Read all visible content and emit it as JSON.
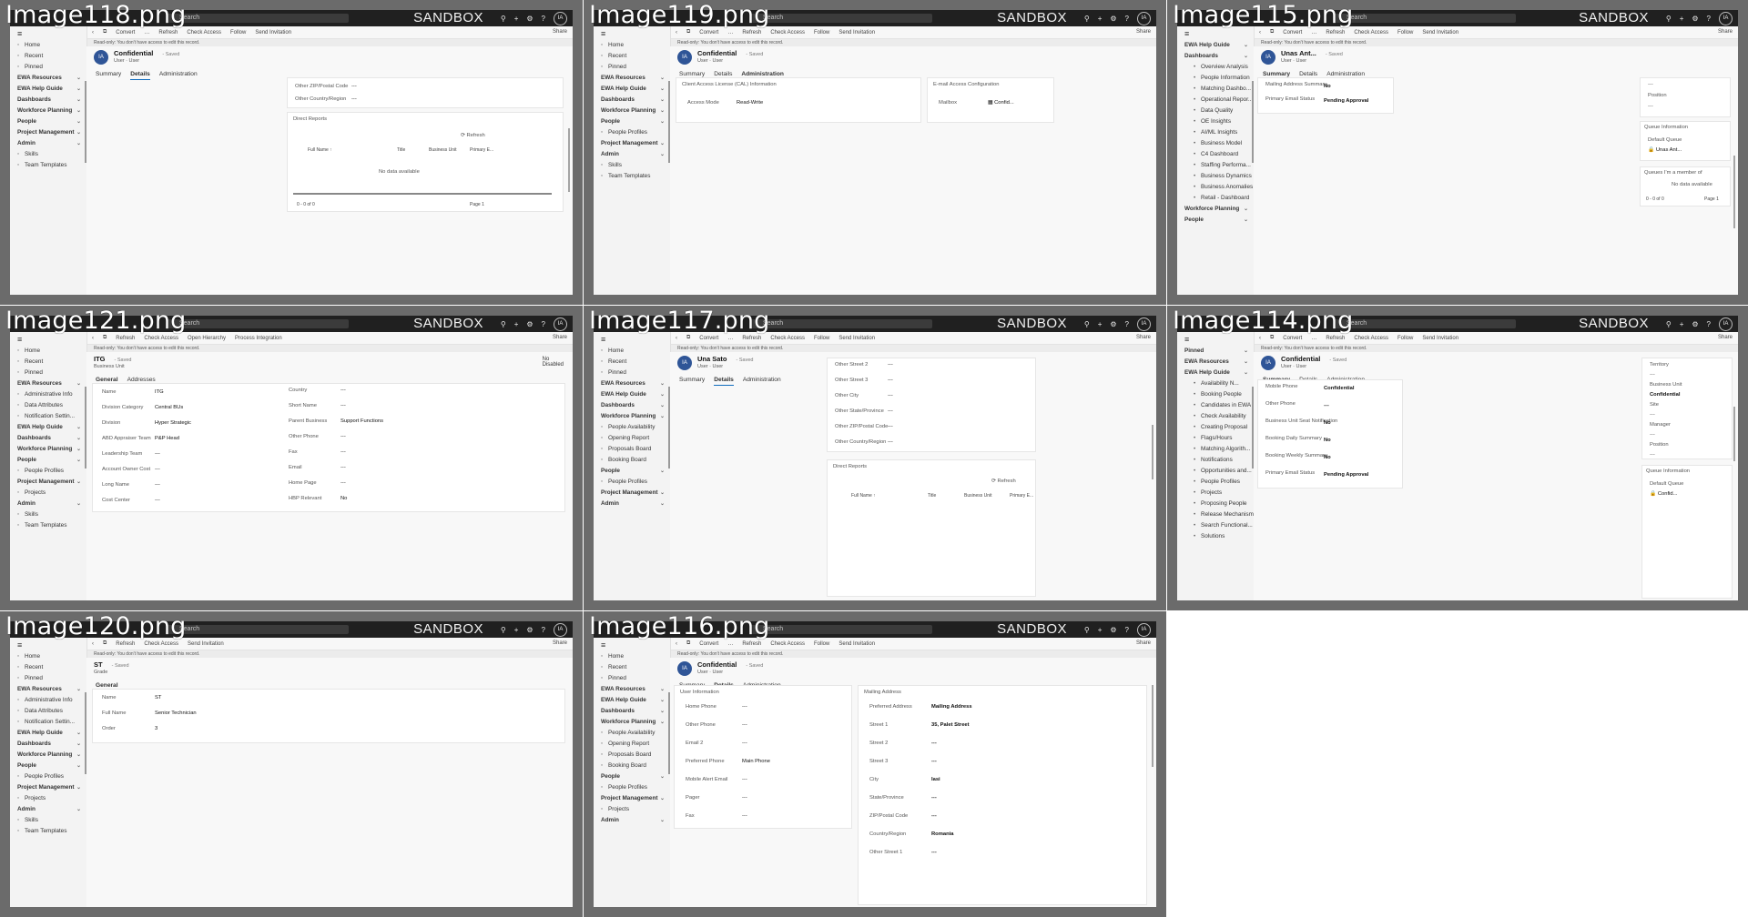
{
  "topbar": {
    "search_placeholder": "Search",
    "env_label": "SANDBOX",
    "avatar_initials": "IA",
    "icon_glyphs": [
      "⚲",
      "+",
      "⚙",
      "?"
    ]
  },
  "common": {
    "share_label": "Share",
    "info_text": "Read-only: You don't have access to edit this record.",
    "cmd_back": "‹",
    "cmd_open": "⧉",
    "saved_label": "- Saved",
    "user_label": "User",
    "user_type_label": "User",
    "empty": "---"
  },
  "cells": [
    {
      "file": "Image118.png",
      "commands": [
        "Convert",
        "…",
        "Refresh",
        "Check Access",
        "Follow",
        "Send Invitation"
      ],
      "nav": [
        {
          "t": "i",
          "label": "Home"
        },
        {
          "t": "i",
          "label": "Recent"
        },
        {
          "t": "i",
          "label": "Pinned"
        },
        {
          "t": "g",
          "label": "EWA Resources"
        },
        {
          "t": "g",
          "label": "EWA Help Guide"
        },
        {
          "t": "g",
          "label": "Dashboards"
        },
        {
          "t": "g",
          "label": "Workforce Planning"
        },
        {
          "t": "g",
          "label": "People"
        },
        {
          "t": "g",
          "label": "Project Management"
        },
        {
          "t": "g",
          "label": "Admin"
        },
        {
          "t": "i",
          "label": "Skills"
        },
        {
          "t": "i",
          "label": "Team Templates"
        }
      ],
      "record_title": "Confidential",
      "tabs": [
        "Summary",
        "Details",
        "Administration"
      ],
      "active_tab": 1,
      "fields": [
        {
          "label": "Other ZIP/Postal Code",
          "value": "---"
        },
        {
          "label": "Other Country/Region",
          "value": "---"
        }
      ],
      "section_title": "Direct Reports",
      "refresh": "Refresh",
      "grid_headers": [
        "Full Name ↑",
        "Title",
        "Business Unit",
        "Primary E..."
      ],
      "no_data": "No data available",
      "pager_left": "0 - 0 of 0",
      "pager_right": "Page 1"
    },
    {
      "file": "Image119.png",
      "commands": [
        "Convert",
        "…",
        "Refresh",
        "Check Access",
        "Follow",
        "Send Invitation"
      ],
      "nav": [
        {
          "t": "i",
          "label": "Home"
        },
        {
          "t": "i",
          "label": "Recent"
        },
        {
          "t": "i",
          "label": "Pinned"
        },
        {
          "t": "g",
          "label": "EWA Resources"
        },
        {
          "t": "g",
          "label": "EWA Help Guide"
        },
        {
          "t": "g",
          "label": "Dashboards"
        },
        {
          "t": "g",
          "label": "Workforce Planning"
        },
        {
          "t": "g",
          "label": "People"
        },
        {
          "t": "i",
          "label": "People Profiles"
        },
        {
          "t": "g",
          "label": "Project Management"
        },
        {
          "t": "g",
          "label": "Admin"
        },
        {
          "t": "i",
          "label": "Skills"
        },
        {
          "t": "i",
          "label": "Team Templates"
        }
      ],
      "record_title": "Confidential",
      "tabs": [
        "Summary",
        "Details",
        "Administration"
      ],
      "active_tab": 2,
      "card1_title": "Client Access License (CAL) Information",
      "card1_field": "Access Mode",
      "card1_value": "Read-Write",
      "card2_title": "E-mail Access Configuration",
      "card2_field": "Mailbox",
      "card2_value": "Confid..."
    },
    {
      "file": "Image115.png",
      "commands": [
        "Convert",
        "…",
        "Refresh",
        "Check Access",
        "Follow",
        "Send Invitation"
      ],
      "nav": [
        {
          "t": "g",
          "label": "EWA Help Guide"
        },
        {
          "t": "g",
          "label": "Dashboards"
        },
        {
          "t": "s",
          "label": "Overview Analysis"
        },
        {
          "t": "s",
          "label": "People Information"
        },
        {
          "t": "s",
          "label": "Matching Dashbo..."
        },
        {
          "t": "s",
          "label": "Operational Repor..."
        },
        {
          "t": "s",
          "label": "Data Quality"
        },
        {
          "t": "s",
          "label": "OE Insights"
        },
        {
          "t": "s",
          "label": "AI/ML Insights"
        },
        {
          "t": "s",
          "label": "Business Model"
        },
        {
          "t": "s",
          "label": "C4 Dashboard"
        },
        {
          "t": "s",
          "label": "Staffing Performa..."
        },
        {
          "t": "s",
          "label": "Business Dynamics"
        },
        {
          "t": "s",
          "label": "Business Anomalies"
        },
        {
          "t": "s",
          "label": "Retail - Dashboard"
        },
        {
          "t": "g",
          "label": "Workforce Planning"
        },
        {
          "t": "g",
          "label": "People"
        }
      ],
      "record_title": "Unas Ant...",
      "tabs": [
        "Summary",
        "Details",
        "Administration"
      ],
      "active_tab": 0,
      "fields": [
        {
          "label": "Mailing Address Summary",
          "value": "No"
        },
        {
          "label": "Primary Email Status",
          "value": "Pending Approval"
        }
      ],
      "right_fields": [
        "---",
        "Position",
        "---"
      ],
      "queue_title": "Queue Information",
      "queue_field": "Default Queue",
      "queue_value": "Unas Ant...",
      "member_title": "Queues I'm a member of",
      "no_data": "No data available",
      "pager_left": "0 - 0 of 0",
      "pager_right": "Page 1"
    },
    {
      "file": "Image121.png",
      "commands": [
        "Refresh",
        "Check Access",
        "Open Hierarchy",
        "Process Integration"
      ],
      "nav": [
        {
          "t": "i",
          "label": "Home"
        },
        {
          "t": "i",
          "label": "Recent"
        },
        {
          "t": "i",
          "label": "Pinned"
        },
        {
          "t": "g",
          "label": "EWA Resources"
        },
        {
          "t": "i",
          "label": "Administrative Info"
        },
        {
          "t": "i",
          "label": "Data Attributes"
        },
        {
          "t": "i",
          "label": "Notification Settin..."
        },
        {
          "t": "g",
          "label": "EWA Help Guide"
        },
        {
          "t": "g",
          "label": "Dashboards"
        },
        {
          "t": "g",
          "label": "Workforce Planning"
        },
        {
          "t": "g",
          "label": "People"
        },
        {
          "t": "i",
          "label": "People Profiles"
        },
        {
          "t": "g",
          "label": "Project Management"
        },
        {
          "t": "i",
          "label": "Projects"
        },
        {
          "t": "g",
          "label": "Admin"
        },
        {
          "t": "i",
          "label": "Skills"
        },
        {
          "t": "i",
          "label": "Team Templates"
        }
      ],
      "record_title": "ITG",
      "record_sub": "Business Unit",
      "side_value": "No",
      "side_label": "Disabled",
      "tabs": [
        "General",
        "Addresses"
      ],
      "active_tab": 0,
      "left_fields": [
        {
          "label": "Name",
          "value": "ITG"
        },
        {
          "label": "Division Category",
          "value": "Central BUs"
        },
        {
          "label": "Division",
          "value": "Hyper Strategic"
        },
        {
          "label": "ABD Appraiser Team",
          "value": "P&P Head"
        },
        {
          "label": "Leadership Team",
          "value": "---"
        },
        {
          "label": "Account Owner Cost",
          "value": "---"
        },
        {
          "label": "Long Name",
          "value": "---"
        },
        {
          "label": "Cost Center",
          "value": "---"
        }
      ],
      "right_fields": [
        {
          "label": "Country",
          "value": "---"
        },
        {
          "label": "Short Name",
          "value": "---"
        },
        {
          "label": "Parent Business",
          "value": "Support Functions"
        },
        {
          "label": "Other Phone",
          "value": "---"
        },
        {
          "label": "Fax",
          "value": "---"
        },
        {
          "label": "Email",
          "value": "---"
        },
        {
          "label": "Home Page",
          "value": "---"
        },
        {
          "label": "HBP Relevant",
          "value": "No"
        }
      ]
    },
    {
      "file": "Image117.png",
      "commands": [
        "Convert",
        "…",
        "Refresh",
        "Check Access",
        "Follow",
        "Send Invitation"
      ],
      "nav": [
        {
          "t": "i",
          "label": "Home"
        },
        {
          "t": "i",
          "label": "Recent"
        },
        {
          "t": "i",
          "label": "Pinned"
        },
        {
          "t": "g",
          "label": "EWA Resources"
        },
        {
          "t": "g",
          "label": "EWA Help Guide"
        },
        {
          "t": "g",
          "label": "Dashboards"
        },
        {
          "t": "g",
          "label": "Workforce Planning"
        },
        {
          "t": "i",
          "label": "People Availability"
        },
        {
          "t": "i",
          "label": "Opening Report"
        },
        {
          "t": "i",
          "label": "Proposals Board"
        },
        {
          "t": "i",
          "label": "Booking Board"
        },
        {
          "t": "g",
          "label": "People"
        },
        {
          "t": "i",
          "label": "People Profiles"
        },
        {
          "t": "g",
          "label": "Project Management"
        },
        {
          "t": "g",
          "label": "Admin"
        }
      ],
      "record_title": "Una Sato",
      "tabs": [
        "Summary",
        "Details",
        "Administration"
      ],
      "active_tab": 1,
      "fields": [
        {
          "label": "Other Street 2",
          "value": "---"
        },
        {
          "label": "Other Street 3",
          "value": "---"
        },
        {
          "label": "Other City",
          "value": "---"
        },
        {
          "label": "Other State/Province",
          "value": "---"
        },
        {
          "label": "Other ZIP/Postal Code",
          "value": "---"
        },
        {
          "label": "Other Country/Region",
          "value": "---"
        }
      ],
      "section_title": "Direct Reports",
      "refresh": "Refresh",
      "grid_headers": [
        "Full Name ↑",
        "Title",
        "Business Unit",
        "Primary E..."
      ]
    },
    {
      "file": "Image114.png",
      "commands": [
        "Convert",
        "…",
        "Refresh",
        "Check Access",
        "Follow",
        "Send Invitation"
      ],
      "nav": [
        {
          "t": "g",
          "label": "Pinned"
        },
        {
          "t": "g",
          "label": "EWA Resources"
        },
        {
          "t": "g",
          "label": "EWA Help Guide"
        },
        {
          "t": "s",
          "label": "Availability N..."
        },
        {
          "t": "s",
          "label": "Booking People"
        },
        {
          "t": "s",
          "label": "Candidates in EWA"
        },
        {
          "t": "s",
          "label": "Check Availability"
        },
        {
          "t": "s",
          "label": "Creating Proposal"
        },
        {
          "t": "s",
          "label": "Flags/Hours"
        },
        {
          "t": "s",
          "label": "Matching Algorith..."
        },
        {
          "t": "s",
          "label": "Notifications"
        },
        {
          "t": "s",
          "label": "Opportunities and..."
        },
        {
          "t": "s",
          "label": "People Profiles"
        },
        {
          "t": "s",
          "label": "Projects"
        },
        {
          "t": "s",
          "label": "Proposing People"
        },
        {
          "t": "s",
          "label": "Release Mechanism"
        },
        {
          "t": "s",
          "label": "Search Functional..."
        },
        {
          "t": "s",
          "label": "Solutions"
        }
      ],
      "record_title": "Confidential",
      "tabs": [
        "Summary",
        "Details",
        "Administration"
      ],
      "active_tab": 0,
      "fields": [
        {
          "label": "Mobile Phone",
          "value": "Confidential"
        },
        {
          "label": "Other Phone",
          "value": "---"
        },
        {
          "label": "Business Unit Seat Notification",
          "value": "No"
        },
        {
          "label": "Booking Daily Summary",
          "value": "No"
        },
        {
          "label": "Booking Weekly Summary",
          "value": "No"
        },
        {
          "label": "Primary Email Status",
          "value": "Pending Approval"
        }
      ],
      "right_fields": [
        "Territory",
        "---",
        "Business Unit",
        "Confidential",
        "Site",
        "---",
        "Manager",
        "---",
        "Position",
        "---"
      ],
      "queue_title": "Queue Information",
      "queue_field": "Default Queue",
      "queue_value": "Confid..."
    },
    {
      "file": "Image120.png",
      "commands": [
        "Refresh",
        "Check Access",
        "Send Invitation"
      ],
      "nav": [
        {
          "t": "i",
          "label": "Home"
        },
        {
          "t": "i",
          "label": "Recent"
        },
        {
          "t": "i",
          "label": "Pinned"
        },
        {
          "t": "g",
          "label": "EWA Resources"
        },
        {
          "t": "i",
          "label": "Administrative Info"
        },
        {
          "t": "i",
          "label": "Data Attributes"
        },
        {
          "t": "i",
          "label": "Notification Settin..."
        },
        {
          "t": "g",
          "label": "EWA Help Guide"
        },
        {
          "t": "g",
          "label": "Dashboards"
        },
        {
          "t": "g",
          "label": "Workforce Planning"
        },
        {
          "t": "g",
          "label": "People"
        },
        {
          "t": "i",
          "label": "People Profiles"
        },
        {
          "t": "g",
          "label": "Project Management"
        },
        {
          "t": "i",
          "label": "Projects"
        },
        {
          "t": "g",
          "label": "Admin"
        },
        {
          "t": "i",
          "label": "Skills"
        },
        {
          "t": "i",
          "label": "Team Templates"
        }
      ],
      "record_title": "ST",
      "record_sub": "Grade",
      "tabs": [
        "General"
      ],
      "active_tab": 0,
      "fields": [
        {
          "label": "Name",
          "value": "ST"
        },
        {
          "label": "Full Name",
          "value": "Senior Technician"
        },
        {
          "label": "Order",
          "value": "3"
        }
      ]
    },
    {
      "file": "Image116.png",
      "commands": [
        "Convert",
        "…",
        "Refresh",
        "Check Access",
        "Follow",
        "Send Invitation"
      ],
      "nav": [
        {
          "t": "i",
          "label": "Home"
        },
        {
          "t": "i",
          "label": "Recent"
        },
        {
          "t": "i",
          "label": "Pinned"
        },
        {
          "t": "g",
          "label": "EWA Resources"
        },
        {
          "t": "g",
          "label": "EWA Help Guide"
        },
        {
          "t": "g",
          "label": "Dashboards"
        },
        {
          "t": "g",
          "label": "Workforce Planning"
        },
        {
          "t": "i",
          "label": "People Availability"
        },
        {
          "t": "i",
          "label": "Opening Report"
        },
        {
          "t": "i",
          "label": "Proposals Board"
        },
        {
          "t": "i",
          "label": "Booking Board"
        },
        {
          "t": "g",
          "label": "People"
        },
        {
          "t": "i",
          "label": "People Profiles"
        },
        {
          "t": "g",
          "label": "Project Management"
        },
        {
          "t": "i",
          "label": "Projects"
        },
        {
          "t": "g",
          "label": "Admin"
        }
      ],
      "record_title": "Confidential",
      "tabs": [
        "Summary",
        "Details",
        "Administration"
      ],
      "active_tab": 1,
      "card1_title": "User Information",
      "card1_fields": [
        {
          "label": "Home Phone",
          "value": "---"
        },
        {
          "label": "Other Phone",
          "value": "---"
        },
        {
          "label": "Email 2",
          "value": "---"
        },
        {
          "label": "Preferred Phone",
          "value": "Main Phone"
        },
        {
          "label": "Mobile Alert Email",
          "value": "---"
        },
        {
          "label": "Pager",
          "value": "---"
        },
        {
          "label": "Fax",
          "value": "---"
        }
      ],
      "card2_title": "Mailing Address",
      "card2_fields": [
        {
          "label": "Preferred Address",
          "value": "Mailing Address"
        },
        {
          "label": "Street 1",
          "value": "35, Palet Street"
        },
        {
          "label": "Street 2",
          "value": "---"
        },
        {
          "label": "Street 3",
          "value": "---"
        },
        {
          "label": "City",
          "value": "Iasi"
        },
        {
          "label": "State/Province",
          "value": "---"
        },
        {
          "label": "ZIP/Postal Code",
          "value": "---"
        },
        {
          "label": "Country/Region",
          "value": "Romania"
        },
        {
          "label": "Other Street 1",
          "value": "---"
        }
      ]
    }
  ]
}
